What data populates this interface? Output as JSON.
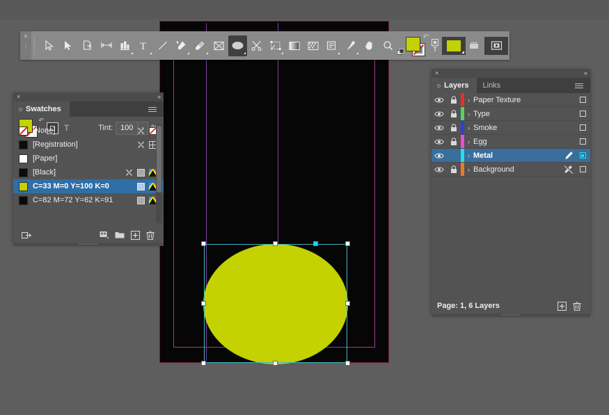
{
  "app": {
    "background_color": "#5c5c5c",
    "accent_color": "#c3d200",
    "selection_color": "#41b6c4"
  },
  "toolbar": {
    "name": "tools-panel",
    "close_label": "×",
    "collapse_label": "»",
    "tools": [
      {
        "id": "selection-tool",
        "label": "Selection Tool"
      },
      {
        "id": "direct-selection-tool",
        "label": "Direct Selection Tool"
      },
      {
        "id": "page-tool",
        "label": "Page Tool"
      },
      {
        "id": "gap-tool",
        "label": "Gap Tool"
      },
      {
        "id": "content-collector-tool",
        "label": "Content Collector Tool"
      },
      {
        "id": "type-tool",
        "label": "Type Tool"
      },
      {
        "id": "line-tool",
        "label": "Line Tool"
      },
      {
        "id": "pen-tool",
        "label": "Pen Tool"
      },
      {
        "id": "pencil-tool",
        "label": "Pencil Tool"
      },
      {
        "id": "rectangle-frame-tool",
        "label": "Rectangle Frame Tool"
      },
      {
        "id": "ellipse-tool",
        "label": "Ellipse Tool",
        "active": true
      },
      {
        "id": "scissors-tool",
        "label": "Scissors Tool"
      },
      {
        "id": "free-transform-tool",
        "label": "Free Transform Tool"
      },
      {
        "id": "gradient-swatch-tool",
        "label": "Gradient Swatch Tool"
      },
      {
        "id": "gradient-feather-tool",
        "label": "Gradient Feather Tool"
      },
      {
        "id": "note-tool",
        "label": "Note Tool"
      },
      {
        "id": "eyedropper-tool",
        "label": "Eyedropper Tool"
      },
      {
        "id": "hand-tool",
        "label": "Hand Tool"
      },
      {
        "id": "zoom-tool",
        "label": "Zoom Tool"
      }
    ],
    "fill_color": "#c3d200",
    "stroke_color": "#ffffff",
    "format_frame_label": "□",
    "format_text_label": "T",
    "apply_color_label": "Apply Color",
    "apply_gradient_label": "Apply Gradient",
    "screen_mode_label": "Screen Mode"
  },
  "swatches_panel": {
    "close_label": "×",
    "collapse_label": "»",
    "tabs": [
      {
        "id": "tab-swatches",
        "label": "Swatches",
        "active": true
      }
    ],
    "menu_label": "Panel Menu",
    "fill_color": "#c3d200",
    "stroke_color": "#fafafa",
    "tint": {
      "label": "Tint:",
      "value": "100",
      "placeholder": "100",
      "unit": "%",
      "arrow_label": "›"
    },
    "swatches": [
      {
        "name": "[None]",
        "color": "none",
        "selected": false,
        "icons": [
          "stroke-x-icon",
          "none-icon"
        ]
      },
      {
        "name": "[Registration]",
        "color": "#0d0d0d",
        "selected": false,
        "icons": [
          "stroke-x-icon",
          "registration-icon"
        ]
      },
      {
        "name": "[Paper]",
        "color": "#ffffff",
        "selected": false,
        "icons": []
      },
      {
        "name": "[Black]",
        "color": "#0d0d0d",
        "selected": false,
        "icons": [
          "stroke-x-icon",
          "spot-icon",
          "cmyk-icon"
        ]
      },
      {
        "name": "C=33 M=0 Y=100 K=0",
        "color": "#c3d200",
        "selected": true,
        "icons": [
          "spot-icon",
          "cmyk-icon"
        ]
      },
      {
        "name": "C=82 M=72 Y=62 K=91",
        "color": "#0a0a0a",
        "selected": false,
        "icons": [
          "spot-icon",
          "cmyk-icon"
        ]
      }
    ],
    "footer": {
      "library_label": "Add to CC Library",
      "group_label": "New Color Group",
      "new_label": "New Swatch",
      "delete_label": "Delete Swatch"
    }
  },
  "layers_panel": {
    "close_label": "×",
    "collapse_label": "»",
    "tabs": [
      {
        "id": "tab-layers",
        "label": "Layers",
        "active": true
      },
      {
        "id": "tab-links",
        "label": "Links",
        "active": false
      }
    ],
    "menu_label": "Panel Menu",
    "layers": [
      {
        "name": "Paper Texture",
        "color": "#ee2d24",
        "visible": true,
        "locked": true,
        "selected": false,
        "targeted": false
      },
      {
        "name": "Type",
        "color": "#4cd964",
        "visible": true,
        "locked": true,
        "selected": false,
        "targeted": false
      },
      {
        "name": "Smoke",
        "color": "#2f3ddf",
        "visible": true,
        "locked": true,
        "selected": false,
        "targeted": false
      },
      {
        "name": "Egg",
        "color": "#ef4bd0",
        "visible": true,
        "locked": true,
        "selected": false,
        "targeted": false
      },
      {
        "name": "Metal",
        "color": "#1ee0f0",
        "visible": true,
        "locked": false,
        "selected": true,
        "targeted": true
      },
      {
        "name": "Background",
        "color": "#f07a20",
        "visible": true,
        "locked": true,
        "selected": false,
        "targeted": false
      }
    ],
    "footer": {
      "status": "Page: 1, 6 Layers",
      "new_label": "New Layer",
      "delete_label": "Delete Layer"
    }
  },
  "document": {
    "page_color": "#060606",
    "bleed_color": "#6b2230",
    "margin_guide_color": "#a03a8e",
    "column_guide_color": "#7d3fa6",
    "selected_object": {
      "name": "ellipse",
      "fill": "#c3d200",
      "handle_color": "#ffffff",
      "active_handle_color": "#16dcf0"
    }
  }
}
